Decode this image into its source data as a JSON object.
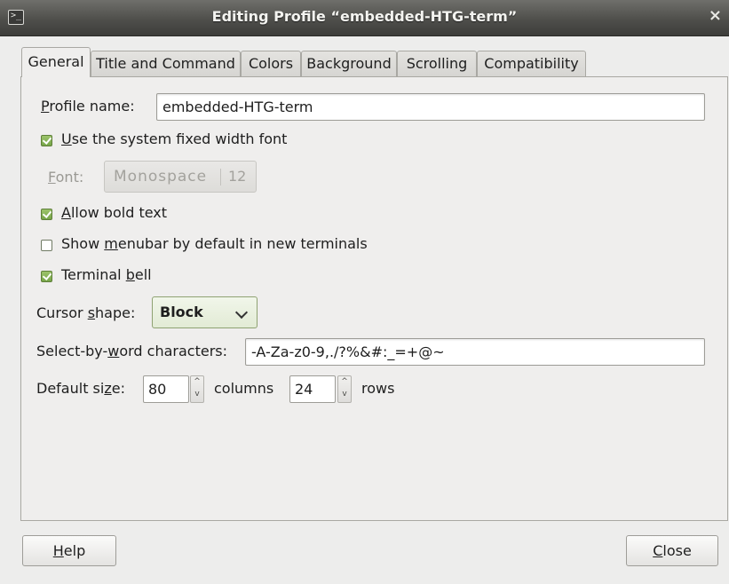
{
  "window": {
    "title": "Editing Profile “embedded-HTG-term”",
    "icon": "terminal-icon",
    "close_glyph": "×"
  },
  "tabs": [
    {
      "label": "General",
      "active": true
    },
    {
      "label": "Title and Command",
      "active": false
    },
    {
      "label": "Colors",
      "active": false
    },
    {
      "label": "Background",
      "active": false
    },
    {
      "label": "Scrolling",
      "active": false
    },
    {
      "label": "Compatibility",
      "active": false
    }
  ],
  "general": {
    "profile_name": {
      "label_prefix": "P",
      "label_rest": "rofile name:",
      "value": "embedded-HTG-term"
    },
    "system_font": {
      "label_prefix": "U",
      "label_rest": "se the system fixed width font",
      "checked": true
    },
    "font": {
      "label_prefix": "F",
      "label_rest": "ont:",
      "name": "Monospace",
      "size": "12",
      "enabled": false
    },
    "bold_text": {
      "label_prefix": "A",
      "label_rest": "llow bold text",
      "checked": true
    },
    "menubar": {
      "label_before": "Show ",
      "label_key": "m",
      "label_after": "enubar by default in new terminals",
      "checked": false
    },
    "bell": {
      "label_before": "Terminal ",
      "label_key": "b",
      "label_after": "ell",
      "checked": true
    },
    "cursor_shape": {
      "label_before": "Cursor ",
      "label_key": "s",
      "label_after": "hape:",
      "value": "Block"
    },
    "word_chars": {
      "label_before": "Select-by-",
      "label_key": "w",
      "label_after": "ord characters:",
      "value": "-A-Za-z0-9,./?%&#:_=+@~"
    },
    "default_size": {
      "label_before": "Default si",
      "label_key": "z",
      "label_after": "e:",
      "columns_value": "80",
      "columns_label": "columns",
      "rows_value": "24",
      "rows_label": "rows"
    }
  },
  "buttons": {
    "help": {
      "key": "H",
      "rest": "elp"
    },
    "close": {
      "key": "C",
      "rest": "lose"
    }
  },
  "colors": {
    "checkbox_checked": "#76a548",
    "titlebar": "#4f4f4b",
    "background": "#ededec"
  }
}
